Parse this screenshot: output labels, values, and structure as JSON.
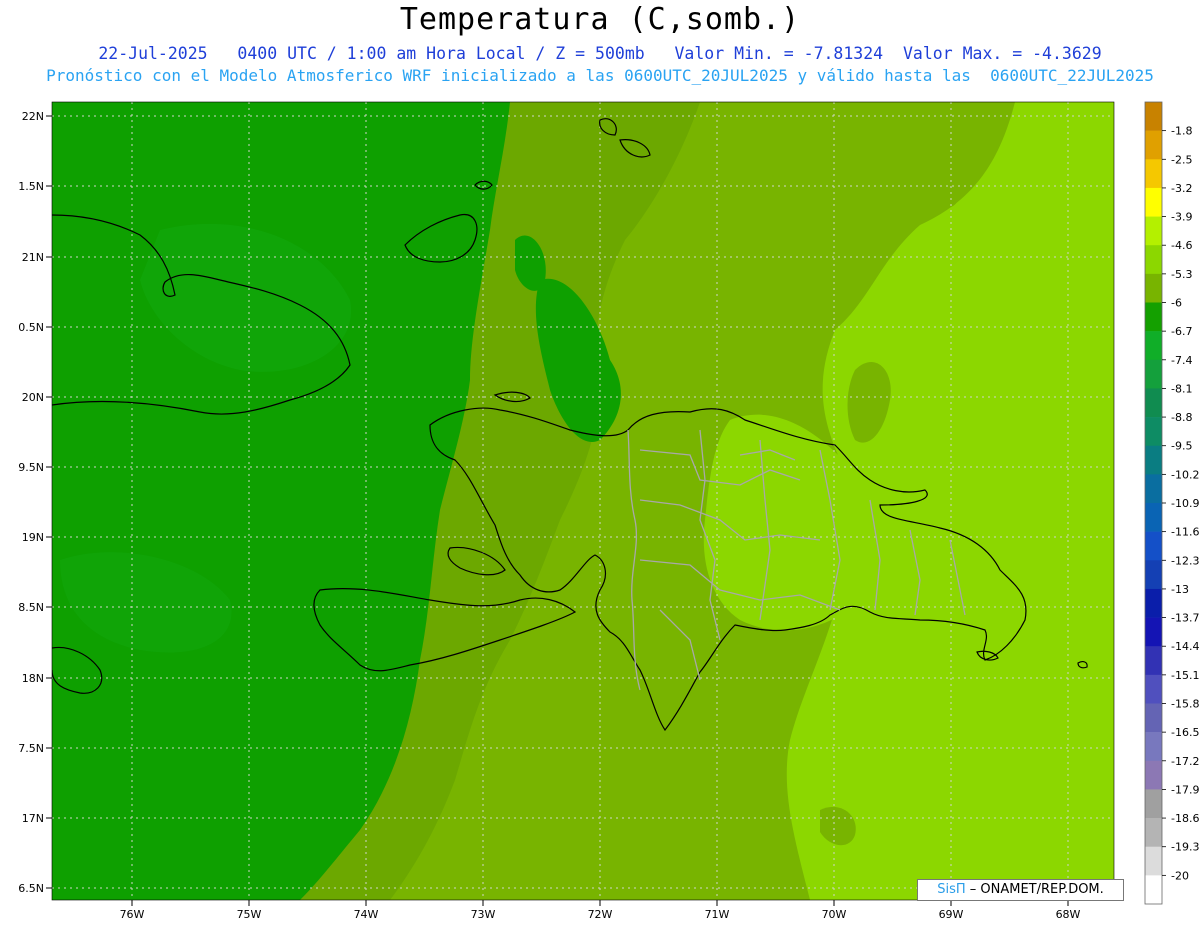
{
  "title": "Temperatura (C,somb.)",
  "subtitle_line1": "22-Jul-2025   0400 UTC / 1:00 am Hora Local / Z = 500mb   Valor Min. = -7.81324  Valor Max. = -4.3629",
  "subtitle_line2": "Pronóstico con el Modelo Atmosferico WRF inicializado a las 0600UTC_20JUL2025 y válido hasta las  0600UTC_22JUL2025",
  "map": {
    "lat_ticks": [
      "22N",
      "1.5N",
      "21N",
      "0.5N",
      "20N",
      "9.5N",
      "19N",
      "8.5N",
      "18N",
      "7.5N",
      "17N",
      "6.5N"
    ],
    "lon_ticks": [
      "76W",
      "75W",
      "74W",
      "73W",
      "72W",
      "71W",
      "70W",
      "69W",
      "68W"
    ]
  },
  "colorbar": {
    "labels": [
      "-1.8",
      "-2.5",
      "-3.2",
      "-3.9",
      "-4.6",
      "-5.3",
      "-6",
      "-6.7",
      "-7.4",
      "-8.1",
      "-8.8",
      "-9.5",
      "-10.2",
      "-10.9",
      "-11.6",
      "-12.3",
      "-13",
      "-13.7",
      "-14.4",
      "-15.1",
      "-15.8",
      "-16.5",
      "-17.2",
      "-17.9",
      "-18.6",
      "-19.3",
      "-20"
    ],
    "colors": [
      "#c88200",
      "#e0a000",
      "#f5c800",
      "#ffff00",
      "#b4f000",
      "#8cd700",
      "#78b400",
      "#14a000",
      "#10ae28",
      "#14a03c",
      "#108c50",
      "#0e8c64",
      "#0a7d82",
      "#0a6ea0",
      "#0a64b4",
      "#1450c8",
      "#1440b4",
      "#0a1eaa",
      "#1414b4",
      "#3232b4",
      "#5050be",
      "#6464b4",
      "#7878be",
      "#8c78b4",
      "#a0a0a0",
      "#b4b4b4",
      "#dcdcdc",
      "#ffffff"
    ]
  },
  "credit": {
    "sis": "SisΠ",
    "rest": "– ONAMET/REP.DOM."
  }
}
